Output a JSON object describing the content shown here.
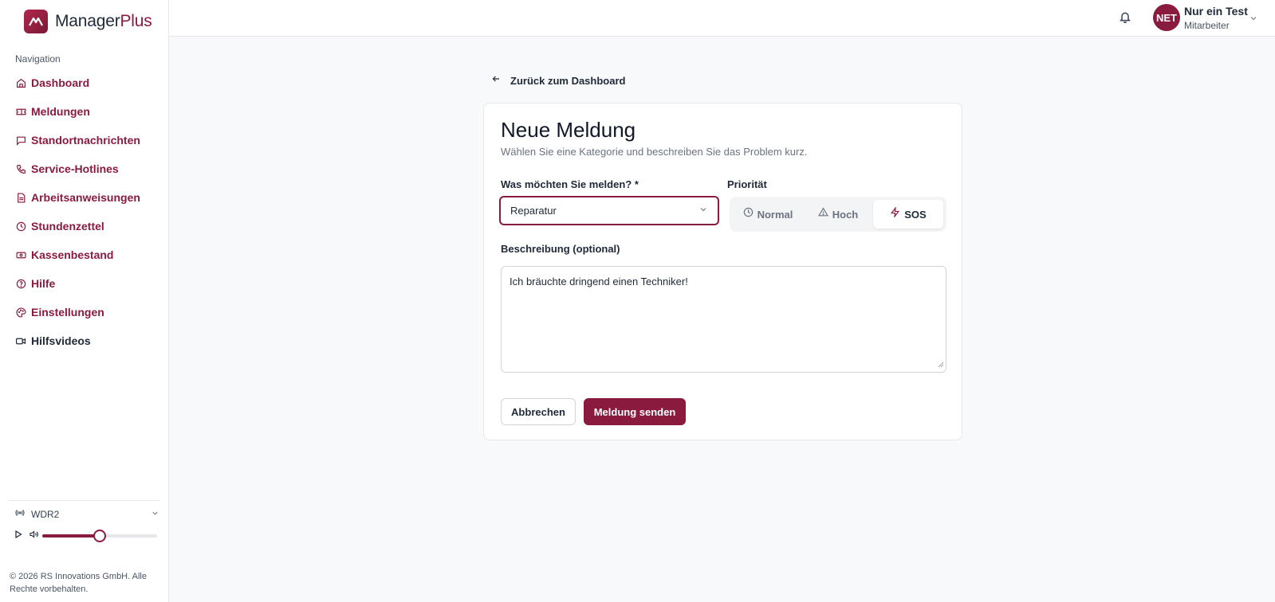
{
  "brand": {
    "name_main": "Manager",
    "name_accent": "Plus"
  },
  "sidebar": {
    "heading": "Navigation",
    "items": [
      {
        "label": "Dashboard",
        "icon": "home-icon"
      },
      {
        "label": "Meldungen",
        "icon": "ticket-icon"
      },
      {
        "label": "Standortnachrichten",
        "icon": "message-square-icon"
      },
      {
        "label": "Service-Hotlines",
        "icon": "phone-icon"
      },
      {
        "label": "Arbeitsanweisungen",
        "icon": "file-text-icon"
      },
      {
        "label": "Stundenzettel",
        "icon": "clock-icon"
      },
      {
        "label": "Kassenbestand",
        "icon": "banknote-icon"
      },
      {
        "label": "Hilfe",
        "icon": "help-circle-icon"
      },
      {
        "label": "Einstellungen",
        "icon": "palette-icon"
      },
      {
        "label": "Hilfsvideos",
        "icon": "video-icon"
      }
    ],
    "radio": {
      "station": "WDR2",
      "volume": 0.5
    },
    "copyright": "© 2026 RS Innovations GmbH. Alle Rechte vorbehalten."
  },
  "topbar": {
    "user_initials": "NET",
    "user_name": "Nur ein Test",
    "user_role": "Mitarbeiter"
  },
  "main": {
    "back_label": "Zurück zum Dashboard",
    "title": "Neue Meldung",
    "subtitle": "Wählen Sie eine Kategorie und beschreiben Sie das Problem kurz.",
    "category_label": "Was möchten Sie melden? *",
    "category_value": "Reparatur",
    "priority_label": "Priorität",
    "priorities": [
      {
        "label": "Normal",
        "icon": "clock-icon"
      },
      {
        "label": "Hoch",
        "icon": "alert-triangle-icon"
      },
      {
        "label": "SOS",
        "icon": "zap-icon"
      }
    ],
    "priority_selected": "SOS",
    "description_label": "Beschreibung (optional)",
    "description_value": "Ich bräuchte dringend einen Techniker!",
    "cancel_label": "Abbrechen",
    "submit_label": "Meldung senden"
  },
  "colors": {
    "accent": "#8b1a3f",
    "background": "#f8f9fb"
  }
}
